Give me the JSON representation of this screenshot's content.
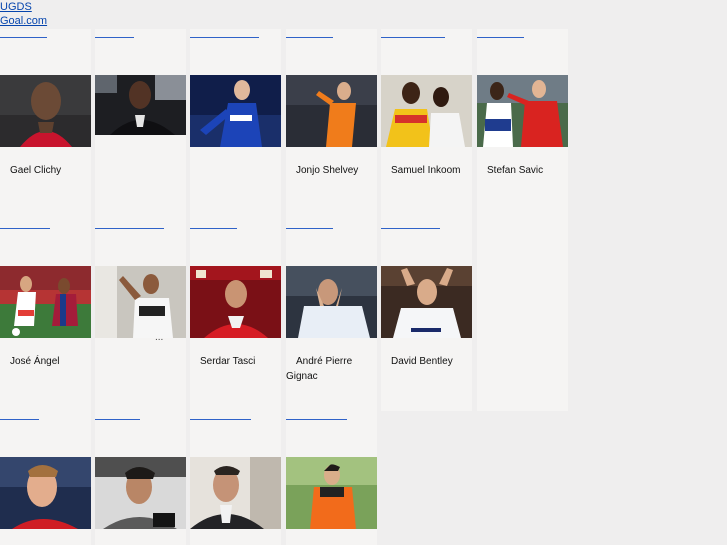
{
  "links": {
    "site": "UGDS",
    "source": "Goal.com"
  },
  "players": [
    {
      "name": "Gael Clichy",
      "bar": 47
    },
    {
      "name": "",
      "bar": 39
    },
    {
      "name": "",
      "bar": 69
    },
    {
      "name": "Jonjo Shelvey",
      "bar": 47
    },
    {
      "name": "Samuel Inkoom",
      "bar": 64
    },
    {
      "name": "Stefan Savic",
      "bar": 47
    },
    {
      "name": "José Ángel",
      "bar": 50
    },
    {
      "name": "",
      "bar": 69
    },
    {
      "name": "Serdar Tasci",
      "bar": 47
    },
    {
      "name": "André Pierre Gignac",
      "bar": 47
    },
    {
      "name": "David Bentley",
      "bar": 59
    },
    {
      "name": "",
      "bar": 39
    },
    {
      "name": "",
      "bar": 45
    },
    {
      "name": "",
      "bar": 61
    },
    {
      "name": "",
      "bar": 61
    }
  ],
  "ellipsis": "..."
}
